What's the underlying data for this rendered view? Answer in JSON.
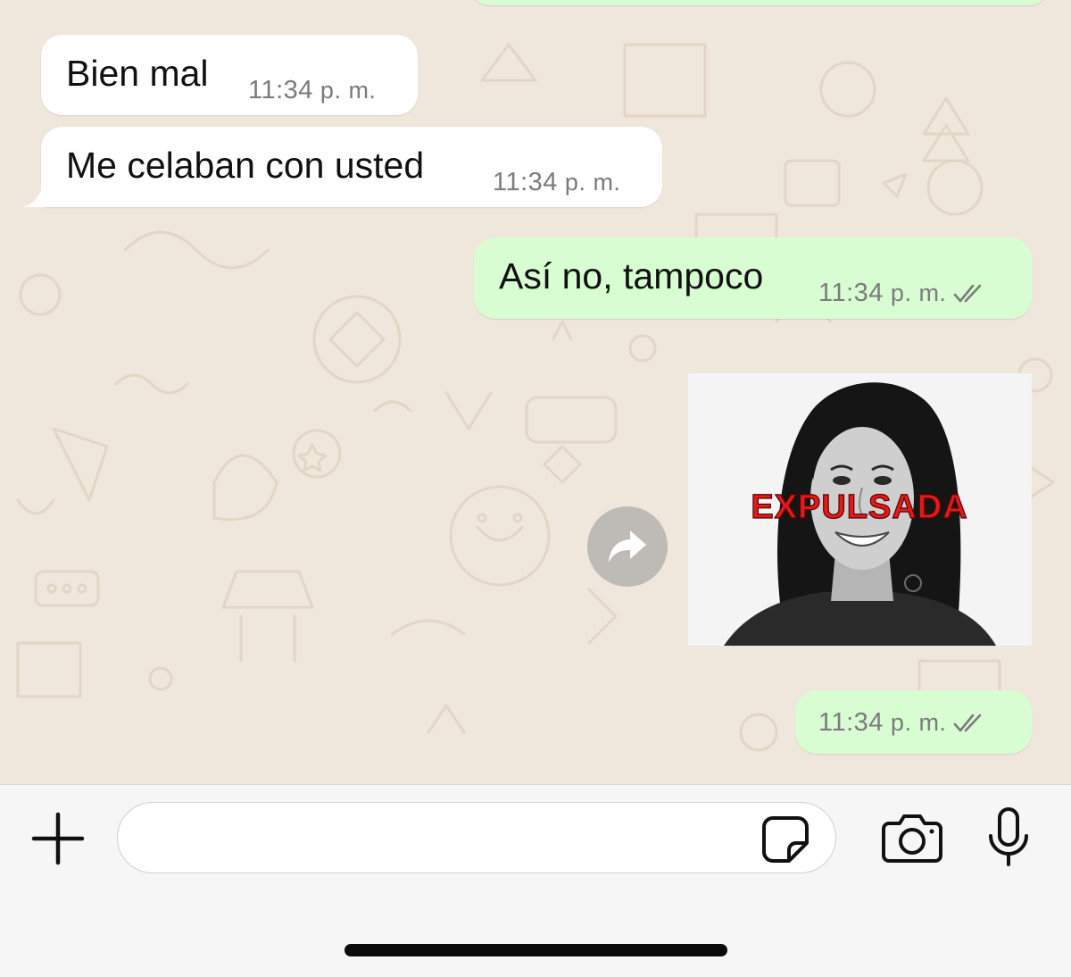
{
  "chat": {
    "wallpaper_color": "#efe7dc",
    "messages": [
      {
        "direction": "incoming",
        "text": "Bien mal",
        "time": "11:34",
        "ampm": "p. m."
      },
      {
        "direction": "incoming",
        "text": "Me celaban con usted",
        "time": "11:34",
        "ampm": "p. m."
      },
      {
        "direction": "outgoing",
        "text": "Así no, tampoco",
        "time": "11:34",
        "ampm": "p. m.",
        "status": "read-ticks-icon"
      },
      {
        "direction": "outgoing",
        "type": "sticker",
        "caption": "EXPULSADA",
        "caption_color": "#e01b1b"
      },
      {
        "direction": "outgoing",
        "text": "",
        "time": "11:34",
        "ampm": "p. m.",
        "status": "read-ticks-icon"
      }
    ],
    "forward_icon": "forward-arrow-icon"
  },
  "composer": {
    "plus_icon": "plus-icon",
    "input_value": "",
    "sticker_icon": "sticker-icon",
    "camera_icon": "camera-icon",
    "mic_icon": "microphone-icon"
  },
  "colors": {
    "incoming_bubble": "#ffffff",
    "outgoing_bubble": "#d9fdd3",
    "meta_text": "#7b7b7b"
  }
}
